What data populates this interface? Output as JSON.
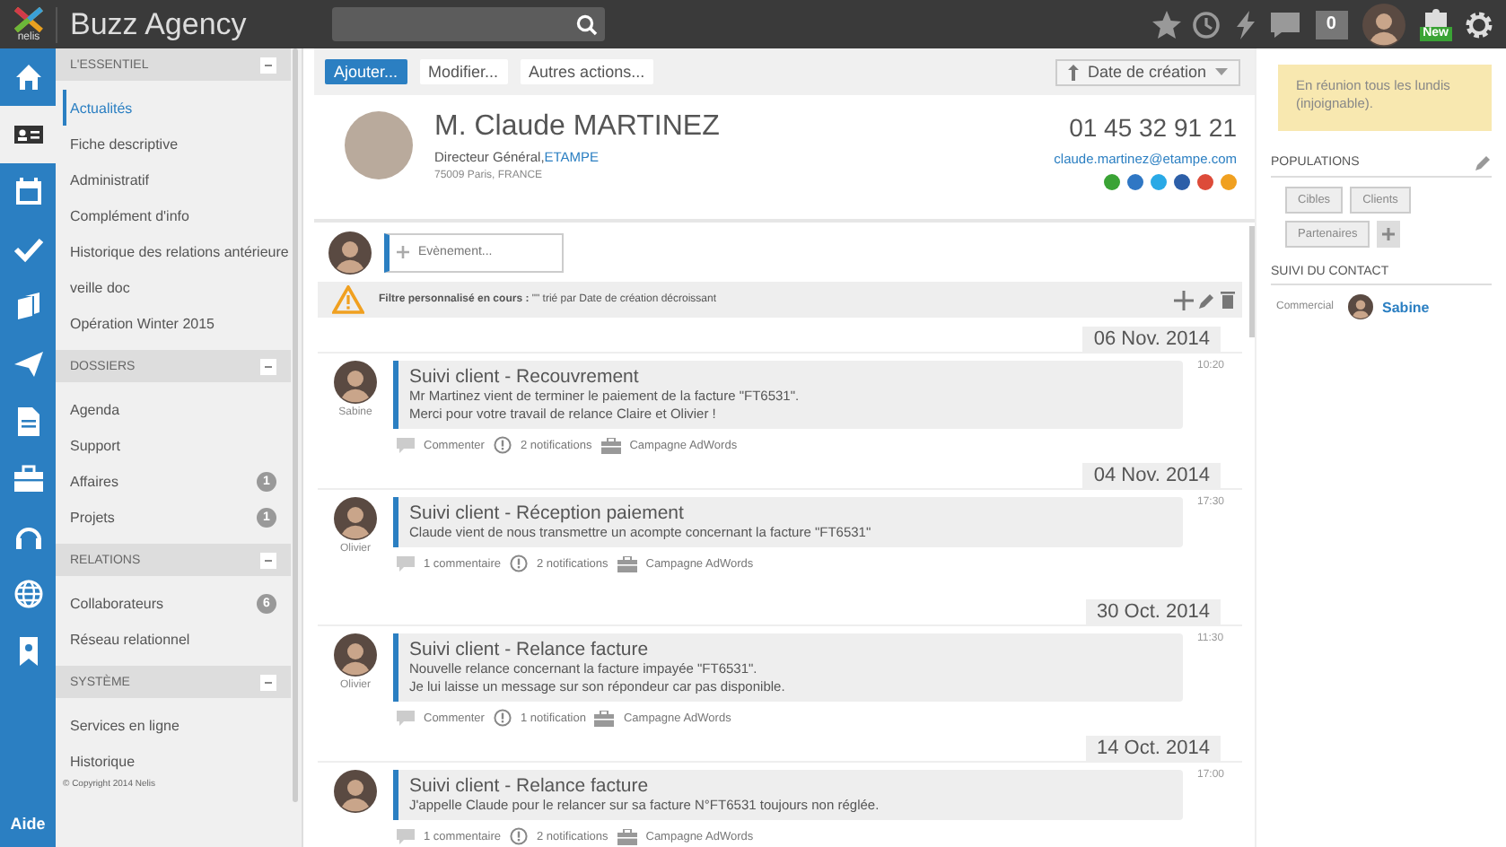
{
  "topbar": {
    "logo_text": "nelis",
    "title": "Buzz Agency",
    "counter": "0",
    "new_badge": "New"
  },
  "rail": {
    "items": [
      {
        "selected": false
      },
      {
        "selected": true
      },
      {
        "selected": false
      },
      {
        "selected": false
      },
      {
        "selected": false
      },
      {
        "selected": false
      },
      {
        "selected": false
      },
      {
        "selected": false
      },
      {
        "selected": false
      },
      {
        "selected": false
      },
      {
        "selected": false
      }
    ],
    "help": "Aide"
  },
  "sidebar": {
    "sections": [
      {
        "title": "L'ESSENTIEL",
        "items": [
          {
            "label": "Actualités",
            "selected": true
          },
          {
            "label": "Fiche descriptive",
            "selected": false
          },
          {
            "label": "Administratif",
            "selected": false
          },
          {
            "label": "Complément d'info",
            "selected": false
          },
          {
            "label": "Historique des relations antérieure",
            "selected": false
          },
          {
            "label": "veille doc",
            "selected": false
          },
          {
            "label": "Opération Winter 2015",
            "selected": false
          }
        ]
      },
      {
        "title": "DOSSIERS",
        "items": [
          {
            "label": "Agenda",
            "selected": false
          },
          {
            "label": "Support",
            "selected": false
          },
          {
            "label": "Affaires",
            "count": "1",
            "selected": false
          },
          {
            "label": "Projets",
            "count": "1",
            "selected": false
          }
        ]
      },
      {
        "title": "RELATIONS",
        "items": [
          {
            "label": "Collaborateurs",
            "count": "6",
            "selected": false
          },
          {
            "label": "Réseau relationnel",
            "selected": false
          }
        ]
      },
      {
        "title": "SYSTÈME",
        "items": [
          {
            "label": "Services en ligne",
            "selected": false
          },
          {
            "label": "Historique",
            "selected": false
          }
        ]
      }
    ],
    "copyright": "© Copyright 2014 Nelis"
  },
  "toolbar": {
    "buttons": [
      {
        "label": "Ajouter...",
        "primary": true
      },
      {
        "label": "Modifier...",
        "primary": false
      },
      {
        "label": "Autres actions...",
        "primary": false
      }
    ],
    "sort": "Date de création"
  },
  "contact": {
    "name": "M. Claude MARTINEZ",
    "role": "Directeur Général, ",
    "company": "ETAMPE",
    "address": "75009 Paris, FRANCE",
    "phone": "01 45 32 91 21",
    "email": "claude.martinez@etampe.com",
    "social": [
      {
        "color": "#3aa335"
      },
      {
        "color": "#2f77c4"
      },
      {
        "color": "#29a9e6"
      },
      {
        "color": "#2d5fa8"
      },
      {
        "color": "#dd4b39"
      },
      {
        "color": "#f0a020"
      }
    ]
  },
  "composer": {
    "placeholder": "Evènement..."
  },
  "filter": {
    "text": "**Filtre personnalisé en cours :** \"\" trié par Date de création décroissant"
  },
  "feed": [
    {
      "date": "06 Nov. 2014",
      "author": "Sabine",
      "title": "Suivi client - Recouvrement",
      "body": [
        "Mr Martinez vient de terminer le paiement de la facture \"FT6531\".",
        "Merci pour votre travail de relance Claire et Olivier !"
      ],
      "time": "10:20",
      "comments": "Commenter",
      "notifications": "2 notifications",
      "campaign": "Campagne AdWords"
    },
    {
      "date": "04 Nov. 2014",
      "author": "Olivier",
      "title": "Suivi client - Réception paiement",
      "body": [
        "Claude vient de nous transmettre un acompte concernant la facture \"FT6531\""
      ],
      "time": "17:30",
      "comments": "1 commentaire",
      "notifications": "2 notifications",
      "campaign": "Campagne AdWords"
    },
    {
      "date": "30 Oct. 2014",
      "author": "Olivier",
      "title": "Suivi client - Relance facture",
      "body": [
        "Nouvelle relance concernant la facture impayée \"FT6531\".",
        "Je lui laisse un message sur son répondeur car pas disponible."
      ],
      "time": "11:30",
      "comments": "Commenter",
      "notifications": "1 notification",
      "campaign": "Campagne AdWords"
    },
    {
      "date": "14 Oct. 2014",
      "title": "Suivi client - Relance facture",
      "body": [
        "J'appelle Claude pour le relancer sur sa facture N°FT6531 toujours non réglée."
      ],
      "time": "17:00",
      "comments": "1 commentaire",
      "notifications": "2 notifications",
      "campaign": "Campagne AdWords"
    }
  ],
  "right": {
    "note": "En réunion tous les lundis (injoignable).",
    "populations": {
      "title": "POPULATIONS",
      "tags": [
        "Cibles",
        "Clients",
        "Partenaires"
      ]
    },
    "follow": {
      "title": "SUIVI DU CONTACT",
      "label": "Commercial",
      "person": "Sabine"
    }
  }
}
